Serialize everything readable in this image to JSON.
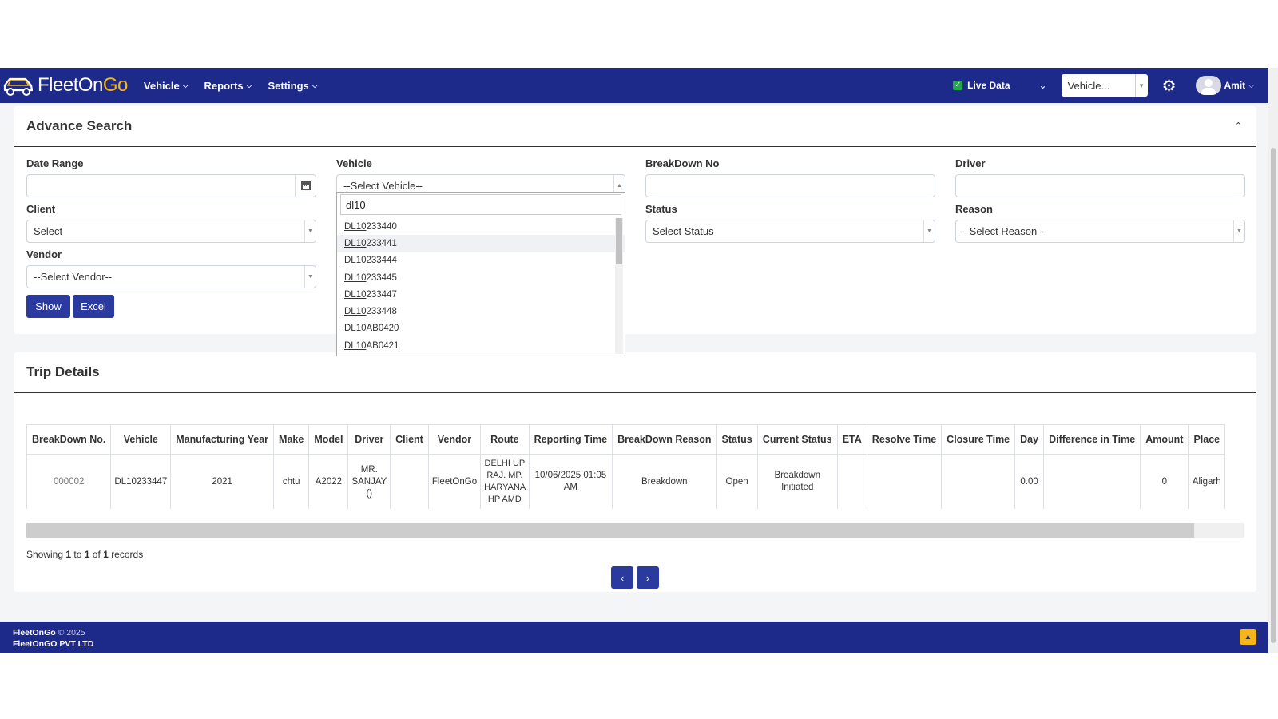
{
  "brand": {
    "logo_prefix": "FleetOn",
    "logo_suffix": "Go"
  },
  "nav": {
    "items": [
      {
        "label": "Vehicle"
      },
      {
        "label": "Reports"
      },
      {
        "label": "Settings"
      }
    ],
    "live_data_label": "Live Data",
    "vehicle_select_value": "Vehicle...",
    "user_name": "Amit"
  },
  "search": {
    "title": "Advance Search",
    "date_range": {
      "label": "Date Range",
      "value": ""
    },
    "vehicle": {
      "label": "Vehicle",
      "value": "--Select Vehicle--"
    },
    "breakdown_no": {
      "label": "BreakDown No",
      "value": ""
    },
    "driver": {
      "label": "Driver",
      "value": ""
    },
    "client": {
      "label": "Client",
      "value": "Select"
    },
    "status": {
      "label": "Status",
      "value": "Select Status"
    },
    "reason": {
      "label": "Reason",
      "value": "--Select Reason--"
    },
    "vendor": {
      "label": "Vendor",
      "value": "--Select Vendor--"
    },
    "show_label": "Show",
    "excel_label": "Excel"
  },
  "vehicle_dropdown": {
    "query": "dl10",
    "options": [
      {
        "match": "DL10",
        "rest": "233440"
      },
      {
        "match": "DL10",
        "rest": "233441"
      },
      {
        "match": "DL10",
        "rest": "233444"
      },
      {
        "match": "DL10",
        "rest": "233445"
      },
      {
        "match": "DL10",
        "rest": "233447"
      },
      {
        "match": "DL10",
        "rest": "233448"
      },
      {
        "match": "DL10",
        "rest": "AB0420"
      },
      {
        "match": "DL10",
        "rest": "AB0421"
      }
    ]
  },
  "trip": {
    "title": "Trip Details",
    "columns": [
      "BreakDown No.",
      "Vehicle",
      "Manufacturing Year",
      "Make",
      "Model",
      "Driver",
      "Client",
      "Vendor",
      "Route",
      "Reporting Time",
      "BreakDown Reason",
      "Status",
      "Current Status",
      "ETA",
      "Resolve Time",
      "Closure Time",
      "Day",
      "Difference in Time",
      "Amount",
      "Place"
    ],
    "rows": [
      {
        "breakdown_no": "000002",
        "vehicle": "DL10233447",
        "manufacturing_year": "2021",
        "make": "chtu",
        "model": "A2022",
        "driver": "MR. SANJAY ()",
        "client": "",
        "vendor": "FleetOnGo",
        "route": "DELHI UP RAJ. MP. HARYANA HP AMD",
        "reporting_time": "10/06/2025 01:05 AM",
        "breakdown_reason": "Breakdown",
        "status": "Open",
        "current_status": "Breakdown Initiated",
        "eta": "",
        "resolve_time": "",
        "closure_time": "",
        "day": "0.00",
        "difference_in_time": "",
        "amount": "0",
        "place": "Aligarh"
      }
    ],
    "showing": {
      "prefix": "Showing",
      "from": "1",
      "to_word": "to",
      "to": "1",
      "of_word": "of",
      "total": "1",
      "suffix": "records"
    }
  },
  "footer": {
    "brand": "FleetOnGo",
    "copyright": "© 2025",
    "company": "FleetOnGO PVT LTD"
  },
  "colors": {
    "navbar": "#1e2a8a",
    "accent": "#2b3a9e",
    "logo_accent": "#f5b51b",
    "live_check": "#22a84a"
  },
  "icons": [
    "car-logo-icon",
    "chevron-down-icon",
    "check-icon",
    "gear-icon",
    "calendar-icon",
    "chevron-up-icon",
    "chevron-left-icon",
    "chevron-right-icon",
    "arrow-up-icon"
  ]
}
